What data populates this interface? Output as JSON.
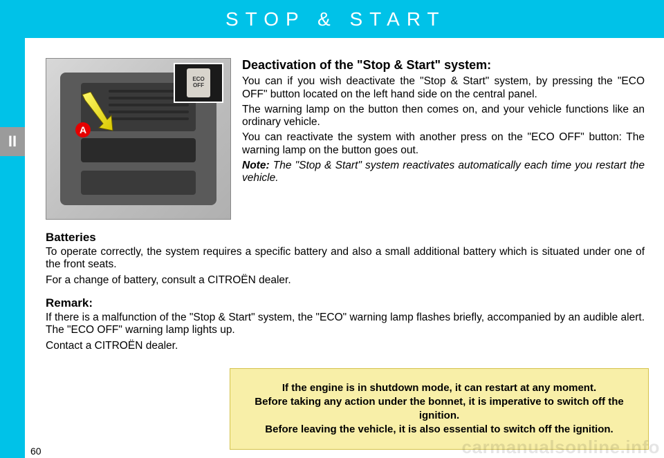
{
  "header": {
    "title": "STOP & START"
  },
  "section_marker": "II",
  "figure": {
    "callout_label": "A",
    "eco_button_line1": "ECO",
    "eco_button_line2": "OFF"
  },
  "main": {
    "heading": "Deactivation of the \"Stop & Start\" system:",
    "p1": "You can if you wish deactivate the \"Stop & Start\" system, by pressing the \"ECO OFF\" button located on the left hand side on the central panel.",
    "p2": "The warning lamp on the button then comes on, and your vehicle functions like an ordinary vehicle.",
    "p3": "You can reactivate the system with another press on the \"ECO OFF\" button: The warning lamp on the button goes out.",
    "note_label": "Note:",
    "note_text": " The \"Stop & Start\" system reactivates automatically each time you restart the vehicle."
  },
  "batteries": {
    "heading": "Batteries",
    "p1": "To operate correctly, the system requires a specific battery and also a small additional battery which is situated under one of the front seats.",
    "p2": "For a change of battery, consult a CITROËN dealer."
  },
  "remark": {
    "heading": "Remark:",
    "p1": "If there is a malfunction of the \"Stop & Start\" system, the \"ECO\" warning lamp flashes briefly, accompanied by an audible alert. The \"ECO OFF\" warning lamp lights up.",
    "p2": "Contact a CITROËN dealer."
  },
  "warning": {
    "line1": "If the engine is in shutdown mode, it can restart at any moment.",
    "line2": "Before taking any action under the bonnet, it is imperative to switch off the ignition.",
    "line3": "Before leaving the vehicle, it is also essential to switch off the ignition."
  },
  "page_number": "60",
  "watermark": "carmanualsonline.info"
}
